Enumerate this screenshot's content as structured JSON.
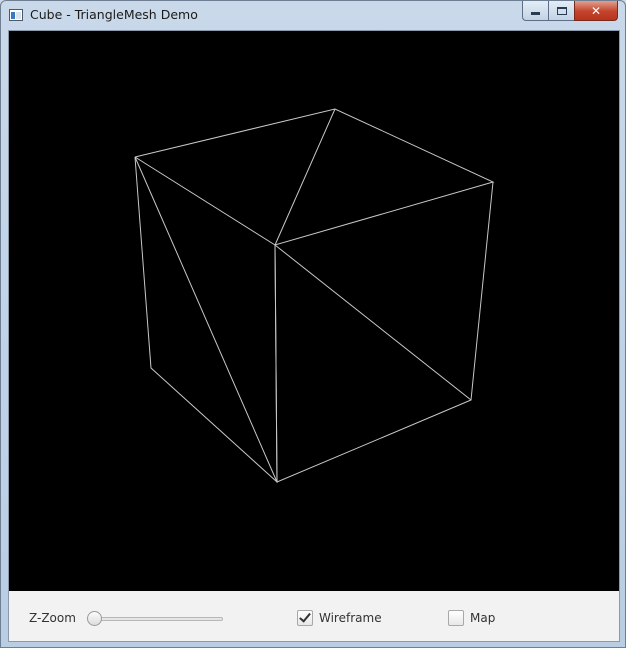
{
  "window": {
    "title": "Cube - TriangleMesh Demo",
    "controls": [
      "minimize",
      "maximize",
      "close"
    ],
    "icon": "app-window-icon"
  },
  "viewport": {
    "background": "#000000",
    "wireframe_color": "#c8c8c8",
    "content": "cube-triangle-mesh-wireframe"
  },
  "controls": {
    "zoom_label": "Z-Zoom",
    "zoom_value_fraction": 0.0,
    "wireframe_label": "Wireframe",
    "wireframe_checked": true,
    "map_label": "Map",
    "map_checked": false
  }
}
